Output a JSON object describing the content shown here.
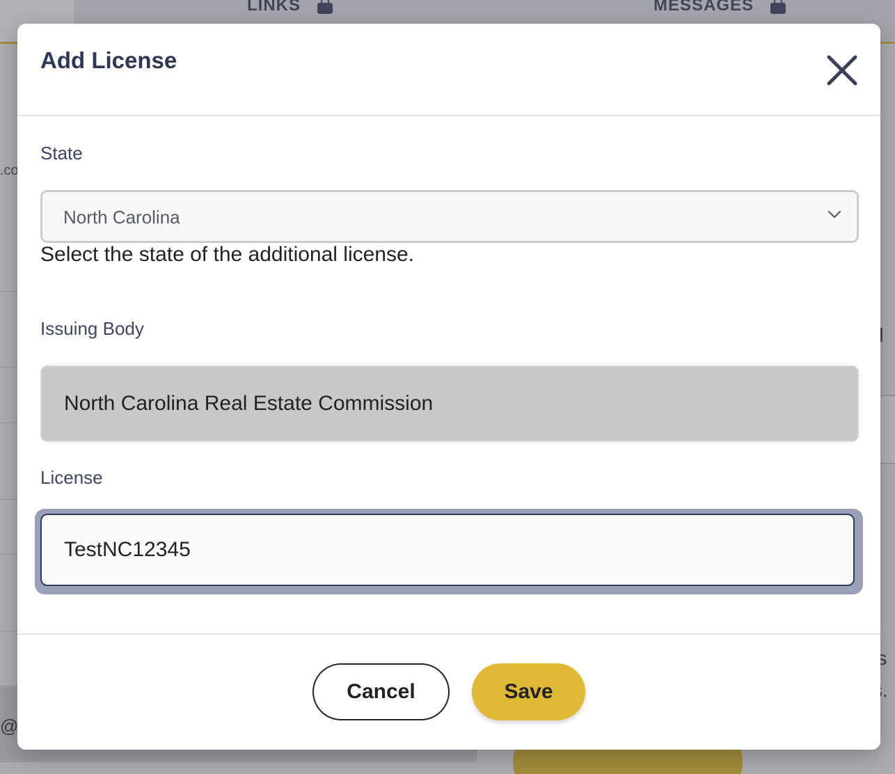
{
  "background": {
    "tabs": [
      {
        "label": "LINKS"
      },
      {
        "label": "MESSAGES"
      }
    ],
    "left_fragment": ".co",
    "right_fragments": [
      "d",
      "is",
      "s."
    ],
    "bottom_left_fragment": "@s"
  },
  "modal": {
    "title": "Add License",
    "close_icon": "close-icon",
    "state": {
      "label": "State",
      "selected": "North Carolina",
      "help": "Select the state of the additional license."
    },
    "issuing_body": {
      "label": "Issuing Body",
      "value": "North Carolina Real Estate Commission"
    },
    "license": {
      "label": "License",
      "value": "TestNC12345"
    },
    "buttons": {
      "cancel": "Cancel",
      "save": "Save"
    }
  },
  "colors": {
    "accent": "#dfb935",
    "title": "#2e3758",
    "focus_ring": "#9aa0b8"
  }
}
